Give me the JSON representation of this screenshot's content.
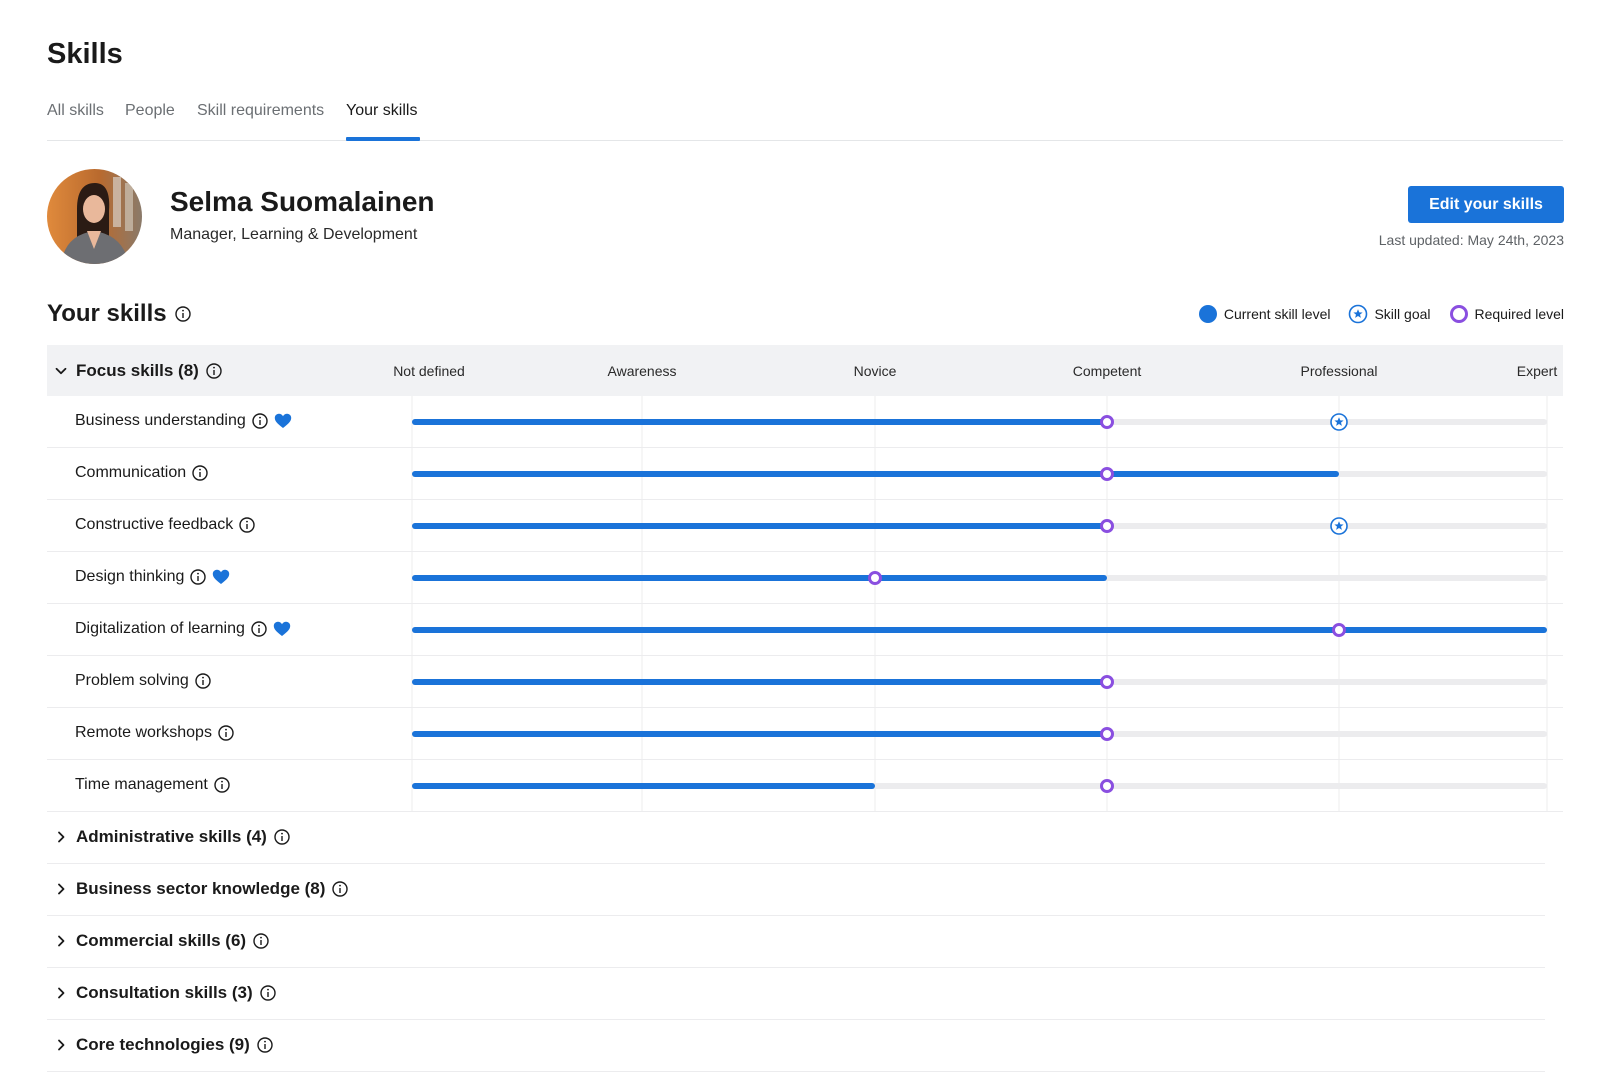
{
  "page": {
    "title": "Skills"
  },
  "tabs": [
    {
      "label": "All skills",
      "active": false
    },
    {
      "label": "People",
      "active": false
    },
    {
      "label": "Skill requirements",
      "active": false
    },
    {
      "label": "Your skills",
      "active": true
    }
  ],
  "profile": {
    "name": "Selma Suomalainen",
    "role": "Manager, Learning & Development",
    "edit_button": "Edit your skills",
    "last_updated": "Last updated: May 24th, 2023"
  },
  "section": {
    "title": "Your skills"
  },
  "legend": {
    "current": "Current skill level",
    "goal": "Skill goal",
    "required": "Required level"
  },
  "colors": {
    "accent": "#1a73d9",
    "required": "#8a4fe0",
    "track": "#ececee"
  },
  "levels": [
    "Not defined",
    "Awareness",
    "Novice",
    "Competent",
    "Professional",
    "Expert"
  ],
  "focus_group": {
    "label": "Focus skills (8)",
    "expanded": true,
    "skills": [
      {
        "name": "Business understanding",
        "favorite": true,
        "current": 3,
        "required": 3,
        "goal": 4
      },
      {
        "name": "Communication",
        "favorite": false,
        "current": 4,
        "required": 3,
        "goal": null
      },
      {
        "name": "Constructive feedback",
        "favorite": false,
        "current": 3,
        "required": 3,
        "goal": 4
      },
      {
        "name": "Design thinking",
        "favorite": true,
        "current": 3,
        "required": 2,
        "goal": null
      },
      {
        "name": "Digitalization of learning",
        "favorite": true,
        "current": 5,
        "required": 4,
        "goal": null
      },
      {
        "name": "Problem solving",
        "favorite": false,
        "current": 3,
        "required": 3,
        "goal": null
      },
      {
        "name": "Remote workshops",
        "favorite": false,
        "current": 3,
        "required": 3,
        "goal": null
      },
      {
        "name": "Time management",
        "favorite": false,
        "current": 2,
        "required": 3,
        "goal": null
      }
    ]
  },
  "collapsed_groups": [
    {
      "label": "Administrative skills (4)"
    },
    {
      "label": "Business sector knowledge (8)"
    },
    {
      "label": "Commercial skills (6)"
    },
    {
      "label": "Consultation skills (3)"
    },
    {
      "label": "Core technologies (9)"
    }
  ]
}
